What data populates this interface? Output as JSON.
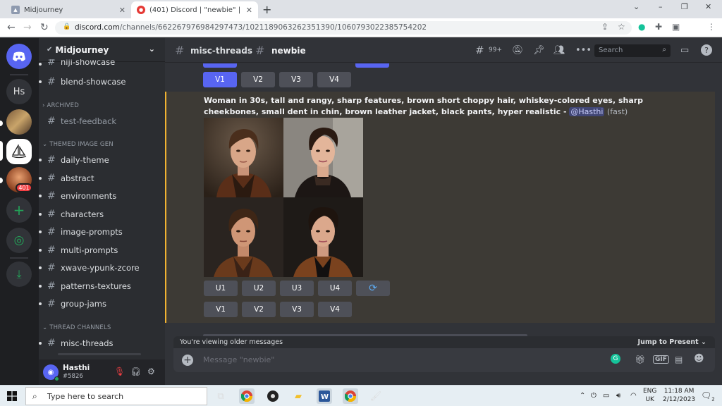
{
  "browser": {
    "tabs": [
      {
        "title": "Midjourney",
        "favicon": "image-icon"
      },
      {
        "title": "(401) Discord | \"newbie\" | Midjou",
        "favicon": "discord-icon"
      }
    ],
    "new_tab": "+",
    "url_domain": "discord.com",
    "url_path": "/channels/662267976984297473/1021189063262351390/1060793022385754202",
    "profile_initial": "H",
    "window_controls": [
      "⌄",
      "–",
      "❐",
      "✕"
    ]
  },
  "rail": {
    "servers": [
      {
        "name": "discord-home",
        "label": ""
      },
      {
        "name": "server-hs",
        "label": "Hs"
      },
      {
        "name": "server-image-1",
        "label": ""
      },
      {
        "name": "server-midjourney",
        "label": ""
      },
      {
        "name": "server-image-2",
        "label": "",
        "badge": "401"
      }
    ],
    "add_server": "+",
    "explore": "◎",
    "download": "⤓"
  },
  "sidebar": {
    "server_name": "Midjourney",
    "channels_top": [
      {
        "name": "niji-showcase"
      },
      {
        "name": "blend-showcase"
      }
    ],
    "categories": {
      "archived": "ARCHIVED",
      "themed": "THEMED IMAGE GEN",
      "thread": "THREAD CHANNELS"
    },
    "archived_channels": [
      {
        "name": "test-feedback"
      }
    ],
    "themed_channels": [
      {
        "name": "daily-theme"
      },
      {
        "name": "abstract"
      },
      {
        "name": "environments"
      },
      {
        "name": "characters"
      },
      {
        "name": "image-prompts"
      },
      {
        "name": "multi-prompts"
      },
      {
        "name": "xwave-ypunk-zcore"
      },
      {
        "name": "patterns-textures"
      },
      {
        "name": "group-jams"
      }
    ],
    "thread_channels": [
      {
        "name": "misc-threads"
      }
    ],
    "user": {
      "name": "Hasthi",
      "tag": "#5826"
    }
  },
  "header": {
    "parent_channel": "misc-threads",
    "thread": "newbie",
    "threads_count": "99+",
    "search_placeholder": "Search"
  },
  "message_top_buttons": [
    "V1",
    "V2",
    "V3",
    "V4"
  ],
  "message": {
    "prompt": "Woman in 30s, tall and rangy, sharp features, brown short choppy hair, whiskey-colored eyes, sharp cheekbones, small dent in chin, brown leather jacket, black pants, hyper realistic",
    "separator": " - ",
    "mention": "@Hasthi",
    "mode": " (fast)",
    "upscale_buttons": [
      "U1",
      "U2",
      "U3",
      "U4"
    ],
    "variation_buttons": [
      "V1",
      "V2",
      "V3",
      "V4"
    ],
    "reroll_icon": "⟳"
  },
  "composer": {
    "older_banner": "You're viewing older messages",
    "jump": "Jump to Present",
    "placeholder": "Message \"newbie\"",
    "gif": "GIF"
  },
  "taskbar": {
    "search_placeholder": "Type here to search",
    "lang_top": "ENG",
    "lang_bottom": "UK",
    "time": "11:18 AM",
    "date": "2/12/2023",
    "notif_count": "2"
  },
  "colors": {
    "blurple": "#5865f2",
    "highlight": "#f0b232",
    "background": "#313338"
  }
}
